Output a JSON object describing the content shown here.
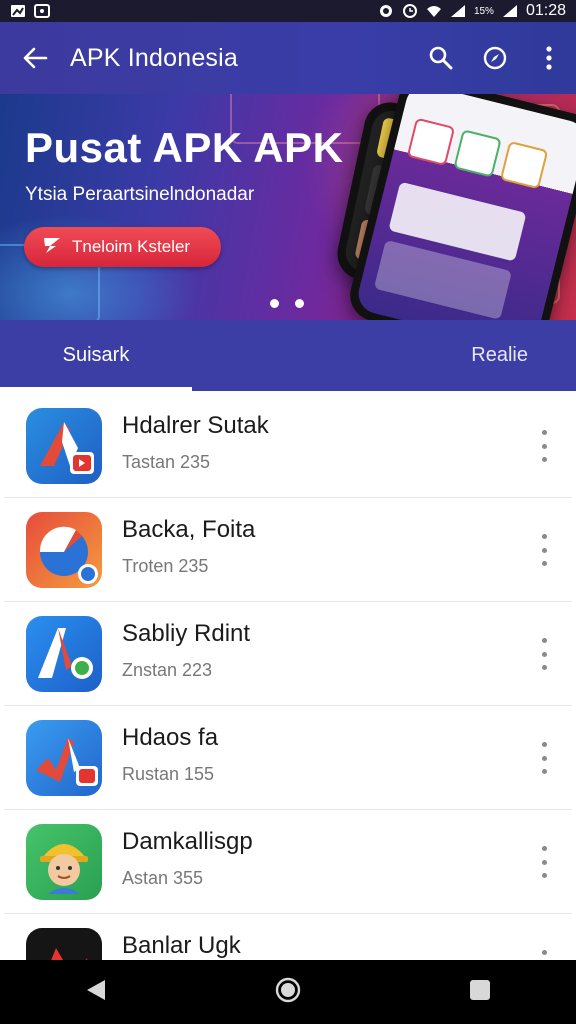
{
  "status_bar": {
    "time": "01:28",
    "battery": "15%",
    "icons": [
      "notification-icon",
      "photo-icon",
      "alarm-icon",
      "clock-icon",
      "wifi-icon",
      "signal-icon",
      "signal-icon",
      "battery-icon"
    ]
  },
  "app_bar": {
    "title": "APK Indonesia",
    "icons": [
      "back-arrow-icon",
      "search-icon",
      "compass-icon",
      "more-vert-icon"
    ]
  },
  "banner": {
    "title": "Pusat APK APK",
    "subtitle": "Ytsia Peraartsinelndonadar",
    "button_label": "Tneloim Ksteler",
    "page_dots": 2
  },
  "tabs": [
    {
      "label": "Suisark",
      "active": true
    },
    {
      "label": "Realie",
      "active": false
    }
  ],
  "apps": [
    {
      "name": "Hdalrer Sutak",
      "meta": "Tastan 235",
      "icon": "blue-red-app-icon"
    },
    {
      "name": "Backa, Foita",
      "meta": "Troten 235",
      "icon": "orange-blue-app-icon"
    },
    {
      "name": "Sabliy Rdint",
      "meta": "Znstan 223",
      "icon": "blue-green-app-icon"
    },
    {
      "name": "Hdaos fa",
      "meta": "Rustan 155",
      "icon": "blue-red-app-icon"
    },
    {
      "name": "Damkallisgp",
      "meta": "Astan 355",
      "icon": "green-character-app-icon"
    },
    {
      "name": "Banlar Ugk",
      "meta": "",
      "icon": "black-red-app-icon"
    }
  ],
  "colors": {
    "app_bar": "#3c3a9e",
    "tabs": "#3c3ea6",
    "banner_button": "#e0303f"
  },
  "nav_bar": {
    "icons": [
      "back-triangle-icon",
      "home-circle-icon",
      "recents-square-icon"
    ]
  }
}
